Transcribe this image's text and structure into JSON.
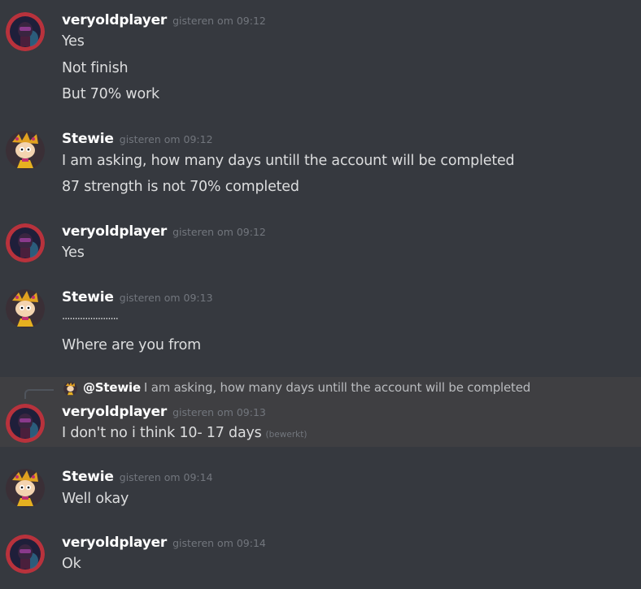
{
  "messages": [
    {
      "author": "veryoldplayer",
      "timestamp": "gisteren om 09:12",
      "avatar": "veryoldplayer-avatar",
      "lines": [
        "Yes",
        "Not finish",
        "But 70% work"
      ]
    },
    {
      "author": "Stewie",
      "timestamp": "gisteren om 09:12",
      "avatar": "stewie-avatar",
      "lines": [
        "I am asking, how many days untill the account will be completed",
        "87 strength is not 70% completed"
      ]
    },
    {
      "author": "veryoldplayer",
      "timestamp": "gisteren om 09:12",
      "avatar": "veryoldplayer-avatar",
      "lines": [
        "Yes"
      ]
    },
    {
      "author": "Stewie",
      "timestamp": "gisteren om 09:13",
      "avatar": "stewie-avatar",
      "lines": [
        "......................",
        "Where are you from"
      ]
    },
    {
      "author": "veryoldplayer",
      "timestamp": "gisteren om 09:13",
      "avatar": "veryoldplayer-avatar",
      "reply": {
        "mention": "@Stewie",
        "text": "I am asking, how many days untill the account will be completed"
      },
      "lines": [
        "I don't no i think 10- 17 days"
      ],
      "edited": "(bewerkt)"
    },
    {
      "author": "Stewie",
      "timestamp": "gisteren om 09:14",
      "avatar": "stewie-avatar",
      "lines": [
        "Well okay"
      ]
    },
    {
      "author": "veryoldplayer",
      "timestamp": "gisteren om 09:14",
      "avatar": "veryoldplayer-avatar",
      "lines": [
        "Ok"
      ]
    }
  ],
  "colors": {
    "background": "#36393f",
    "highlight": "#3f3f42",
    "author": "#ffffff",
    "text": "#dcddde",
    "timestamp": "#72767d"
  }
}
